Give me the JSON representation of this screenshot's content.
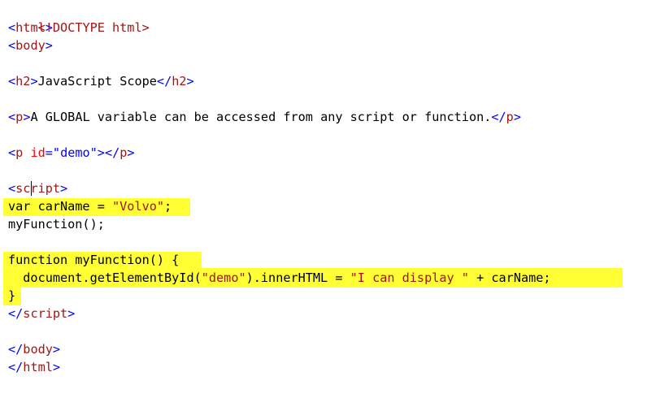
{
  "code": {
    "doctype": "<!DOCTYPE html>",
    "html_open_tag": "html",
    "body_open_tag": "body",
    "h2_open_tag": "h2",
    "h2_text": "JavaScript Scope",
    "h2_close_tag": "h2",
    "p_open_tag": "p",
    "p_text": "A GLOBAL variable can be accessed from any script or function.",
    "p_close_tag": "p",
    "p2_tag": "p",
    "p2_attr_name": "id",
    "p2_equals": "=",
    "p2_attr_value": "\"demo\"",
    "p2_close_tag": "p",
    "script_open_tag": "script",
    "js_line1_pre": "var carName = ",
    "js_line1_str": "\"Volvo\"",
    "js_line1_post": ";",
    "js_line2": "myFunction();",
    "js_line3": "function myFunction() {",
    "js_line4_pre": "  document.getElementById(",
    "js_line4_str1": "\"demo\"",
    "js_line4_mid": ").innerHTML = ",
    "js_line4_str2": "\"I can display \"",
    "js_line4_post": " + carName;",
    "js_line5": "}",
    "script_close_tag": "script",
    "body_close_tag": "body",
    "html_close_tag": "html"
  },
  "highlight_color": "#ffff33",
  "colors": {
    "tag": "#a31515",
    "bracket": "#0000ff",
    "attribute": "#ff0000",
    "string": "#0000ff"
  }
}
